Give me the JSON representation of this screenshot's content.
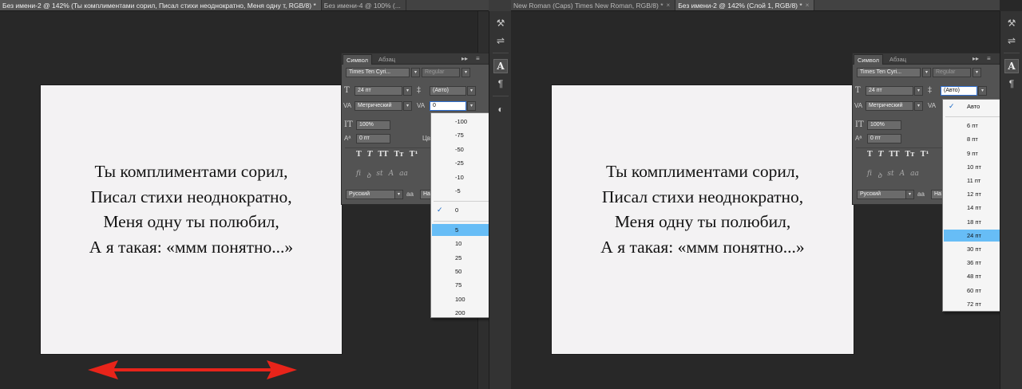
{
  "left_window": {
    "tabs": [
      {
        "label": "Без имени-2 @ 142% (Ты комплиментами сорил,  Писал стихи неоднократно,  Меня одну т, RGB/8) *",
        "active": true
      },
      {
        "label": "Без имени-4 @ 100% (...",
        "active": false
      }
    ],
    "poem": [
      "Ты комплиментами сорил,",
      "Писал стихи неоднократно,",
      "Меня одну ты полюбил,",
      "А я такая: «ммм понятно...»"
    ],
    "panel": {
      "tab_character": "Символ",
      "tab_paragraph": "Абзац",
      "font_family": "Times Ten Cyri...",
      "font_style": "Regular",
      "font_size": "24 пт",
      "leading": "(Авто)",
      "kerning": "Метрический",
      "tracking_value": "0",
      "vertical_scale": "100%",
      "baseline_shift": "0 пт",
      "color_label": "Цв",
      "language": "Русский",
      "antialias_label": "аа",
      "antialias_value": "На"
    },
    "tracking_dropdown": {
      "items": [
        "-100",
        "-75",
        "-50",
        "-25",
        "-10",
        "-5",
        "0",
        "5",
        "10",
        "25",
        "50",
        "75",
        "100",
        "200"
      ],
      "checked": "0",
      "highlighted": "5"
    }
  },
  "right_window": {
    "tabs": [
      {
        "label": "New Roman (Caps) Times New Roman, RGB/8) *",
        "active": false
      },
      {
        "label": "Без имени-2 @ 142% (Слой 1, RGB/8) *",
        "active": true
      }
    ],
    "poem": [
      "Ты комплиментами сорил,",
      "Писал стихи неоднократно,",
      "Меня одну ты полюбил,",
      "А я такая: «ммм понятно...»"
    ],
    "panel": {
      "tab_character": "Символ",
      "tab_paragraph": "Абзац",
      "font_family": "Times Ten Cyri...",
      "font_style": "Regular",
      "font_size": "24 пт",
      "leading": "(Авто)",
      "kerning": "Метрический",
      "vertical_scale": "100%",
      "baseline_shift": "0 пт",
      "language": "Русский",
      "antialias_label": "аа",
      "antialias_value": "На"
    },
    "leading_dropdown": {
      "items": [
        "Авто",
        "6 пт",
        "8 пт",
        "9 пт",
        "10 пт",
        "11 пт",
        "12 пт",
        "14 пт",
        "18 пт",
        "24 пт",
        "30 пт",
        "36 пт",
        "48 пт",
        "60 пт",
        "72 пт"
      ],
      "checked": "Авто",
      "highlighted": "24 пт"
    }
  },
  "icons": {
    "check": "✓",
    "close": "×",
    "caret": "▾",
    "panel_menu": "≡"
  },
  "colors": {
    "highlight": "#67bdf6",
    "arrow": "#e8241a"
  }
}
